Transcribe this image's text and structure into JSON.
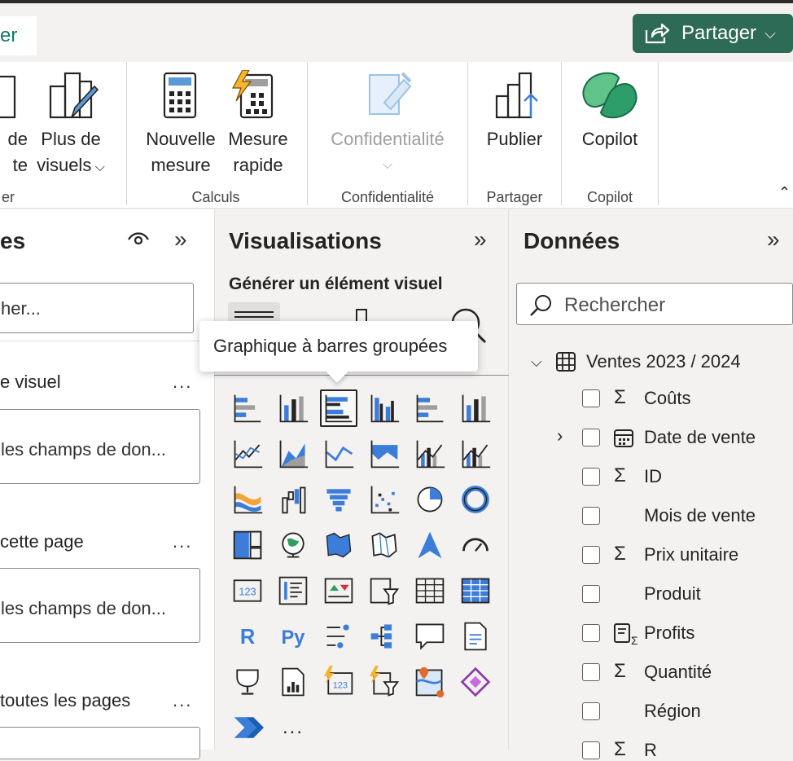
{
  "ribbon": {
    "active_tab_partial": "er",
    "share_label": "Partager",
    "buttons": {
      "partial_btn_l1": "de",
      "partial_btn_l2": "te",
      "more_visuals_l1": "Plus de",
      "more_visuals_l2": "visuels",
      "new_measure_l1": "Nouvelle",
      "new_measure_l2": "mesure",
      "quick_measure_l1": "Mesure",
      "quick_measure_l2": "rapide",
      "sensitivity": "Confidentialité",
      "publish": "Publier",
      "copilot": "Copilot"
    },
    "groups": {
      "partial": "er",
      "calculations": "Calculs",
      "sensitivity": "Confidentialité",
      "share": "Partager",
      "copilot": "Copilot"
    }
  },
  "filters_pane": {
    "title_partial": "es",
    "search_partial": "her...",
    "section1": "e visuel",
    "drop1": "les champs de don...",
    "section2": "cette page",
    "drop2": "les champs de don...",
    "section3": "toutes les pages",
    "more": "..."
  },
  "visualizations_pane": {
    "title": "Visualisations",
    "build_label": "Générer un élément visuel",
    "tooltip": "Graphique à barres groupées",
    "more": "...",
    "visual_icons": [
      "stacked-bar-chart",
      "stacked-column-chart",
      "clustered-bar-chart",
      "clustered-column-chart",
      "100-stacked-bar-chart",
      "100-stacked-column-chart",
      "line-chart",
      "area-chart",
      "stacked-area-chart",
      "100-stacked-area-chart",
      "line-and-stacked-column-chart",
      "line-and-clustered-column-chart",
      "ribbon-chart",
      "waterfall-chart",
      "funnel-chart",
      "scatter-chart",
      "pie-chart",
      "donut-chart",
      "treemap",
      "map",
      "filled-map",
      "shape-map",
      "azure-map",
      "gauge",
      "card",
      "multi-row-card",
      "kpi",
      "slicer",
      "table",
      "matrix",
      "r-script-visual",
      "python-visual",
      "key-influencers",
      "decomposition-tree",
      "qa-visual",
      "smart-narrative",
      "metrics",
      "paginated-report",
      "quick-insights-card",
      "quick-insights-slicer",
      "arcgis-map",
      "power-apps",
      "power-automate"
    ]
  },
  "data_pane": {
    "title": "Données",
    "search_placeholder": "Rechercher",
    "table_name": "Ventes 2023 / 2024",
    "fields": [
      {
        "name": "Coûts",
        "sigma": true
      },
      {
        "name": "Date de vente",
        "sigma": false
      },
      {
        "name": "ID",
        "sigma": true
      },
      {
        "name": "Mois de vente",
        "sigma": false
      },
      {
        "name": "Prix unitaire",
        "sigma": true
      },
      {
        "name": "Produit",
        "sigma": false
      },
      {
        "name": "Profits",
        "sigma": false
      },
      {
        "name": "Quantité",
        "sigma": true
      },
      {
        "name": "Région",
        "sigma": false
      },
      {
        "name": "R",
        "sigma": true
      }
    ]
  },
  "colors": {
    "accent_green": "#2e6b56",
    "visual_blue": "#3b7dd8"
  }
}
